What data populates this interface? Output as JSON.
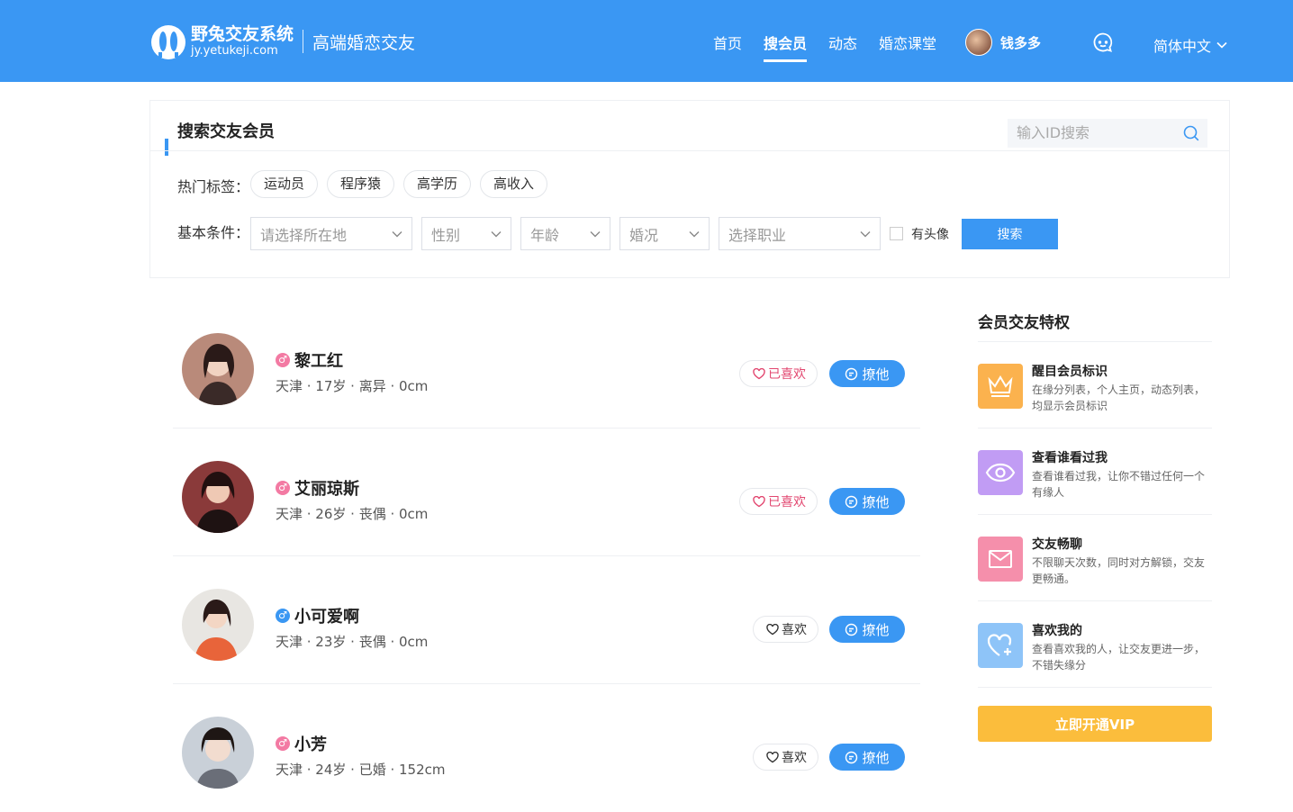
{
  "header": {
    "logo_title": "野兔交友系统",
    "logo_url": "jy.yetukeji.com",
    "slogan": "高端婚恋交友",
    "nav": [
      {
        "label": "首页",
        "active": false
      },
      {
        "label": "搜会员",
        "active": true
      },
      {
        "label": "动态",
        "active": false
      },
      {
        "label": "婚恋课堂",
        "active": false
      }
    ],
    "user_name": "钱多多",
    "language": "简体中文"
  },
  "search": {
    "title": "搜索交友会员",
    "id_placeholder": "输入ID搜索",
    "hot_tags_label": "热门标签：",
    "hot_tags": [
      "运动员",
      "程序猿",
      "高学历",
      "高收入"
    ],
    "basic_label": "基本条件：",
    "filters": {
      "location": "请选择所在地",
      "gender": "性别",
      "age": "年龄",
      "marital": "婚况",
      "job": "选择职业"
    },
    "avatar_checkbox_label": "有头像",
    "search_button": "搜索"
  },
  "members": [
    {
      "name": "黎工红",
      "gender_symbol": "♂",
      "info": "天津 · 17岁 · 离异 · 0cm",
      "like_label": "已喜欢",
      "liked": true,
      "flirt_label": "撩他"
    },
    {
      "name": "艾丽琼斯",
      "gender_symbol": "♂",
      "info": "天津 · 26岁 · 丧偶 · 0cm",
      "like_label": "已喜欢",
      "liked": true,
      "flirt_label": "撩他"
    },
    {
      "name": "小可爱啊",
      "gender_symbol": "♂",
      "info": "天津 · 23岁 · 丧偶 · 0cm",
      "like_label": "喜欢",
      "liked": false,
      "flirt_label": "撩他"
    },
    {
      "name": "小芳",
      "gender_symbol": "♂",
      "info": "天津 · 24岁 · 已婚 · 152cm",
      "like_label": "喜欢",
      "liked": false,
      "flirt_label": "撩他"
    }
  ],
  "sidebar": {
    "title": "会员交友特权",
    "perks": [
      {
        "title": "醒目会员标识",
        "desc": "在缘分列表，个人主页，动态列表，均显示会员标识",
        "icon": "crown-icon",
        "color": "#fbb24e"
      },
      {
        "title": "查看谁看过我",
        "desc": "查看谁看过我，让你不错过任何一个有缘人",
        "icon": "eye-icon",
        "color": "#c19cf4"
      },
      {
        "title": "交友畅聊",
        "desc": "不限聊天次数，同时对方解锁，交友更畅通。",
        "icon": "mail-icon",
        "color": "#f58fab"
      },
      {
        "title": "喜欢我的",
        "desc": "查看喜欢我的人，让交友更进一步，不错失缘分",
        "icon": "heart-plus-icon",
        "color": "#8ec4f8"
      }
    ],
    "vip_button": "立即开通VIP"
  },
  "colors": {
    "brand": "#3a97f3",
    "liked": "#e2466f",
    "vip": "#fbbd3c"
  }
}
